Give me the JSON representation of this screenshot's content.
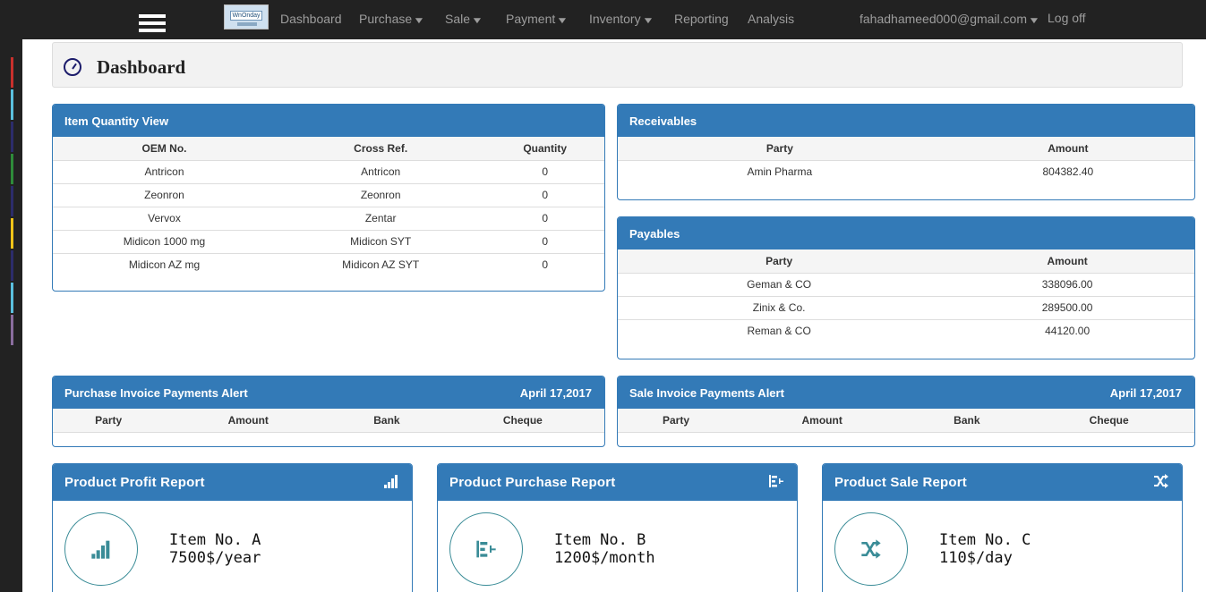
{
  "nav": {
    "logo_text": "WnOnday",
    "links": [
      {
        "label": "Dashboard",
        "dropdown": false
      },
      {
        "label": "Purchase",
        "dropdown": true
      },
      {
        "label": "Sale",
        "dropdown": true
      },
      {
        "label": "Payment",
        "dropdown": true
      },
      {
        "label": "Inventory",
        "dropdown": true
      },
      {
        "label": "Reporting",
        "dropdown": false
      },
      {
        "label": "Analysis",
        "dropdown": false
      }
    ],
    "user_email": "fahadhameed000@gmail.com",
    "logoff": "Log off"
  },
  "page": {
    "title": "Dashboard"
  },
  "item_quantity": {
    "title": "Item Quantity View",
    "headers": [
      "OEM No.",
      "Cross Ref.",
      "Quantity"
    ],
    "rows": [
      [
        "Antricon",
        "Antricon",
        "0"
      ],
      [
        "Zeonron",
        "Zeonron",
        "0"
      ],
      [
        "Vervox",
        "Zentar",
        "0"
      ],
      [
        "Midicon 1000 mg",
        "Midicon SYT",
        "0"
      ],
      [
        "Midicon AZ mg",
        "Midicon AZ SYT",
        "0"
      ]
    ]
  },
  "receivables": {
    "title": "Receivables",
    "headers": [
      "Party",
      "Amount"
    ],
    "rows": [
      [
        "Amin Pharma",
        "804382.40"
      ]
    ]
  },
  "payables": {
    "title": "Payables",
    "headers": [
      "Party",
      "Amount"
    ],
    "rows": [
      [
        "Geman & CO",
        "338096.00"
      ],
      [
        "Zinix & Co.",
        "289500.00"
      ],
      [
        "Reman & CO",
        "44120.00"
      ]
    ]
  },
  "purchase_alert": {
    "title": "Purchase Invoice Payments Alert",
    "date": "April 17,2017",
    "headers": [
      "Party",
      "Amount",
      "Bank",
      "Cheque"
    ]
  },
  "sale_alert": {
    "title": "Sale Invoice Payments Alert",
    "date": "April 17,2017",
    "headers": [
      "Party",
      "Amount",
      "Bank",
      "Cheque"
    ]
  },
  "reports": [
    {
      "title": "Product Profit Report",
      "icon": "signal-bars-icon",
      "item": "Item No. A",
      "value": "7500$/year"
    },
    {
      "title": "Product Purchase Report",
      "icon": "align-bars-icon",
      "item": "Item No. B",
      "value": "1200$/month"
    },
    {
      "title": "Product Sale Report",
      "icon": "shuffle-icon",
      "item": "Item No. C",
      "value": "110$/day"
    }
  ],
  "colors": {
    "navbar": "#222222",
    "panel_primary": "#337ab7",
    "icon_teal": "#3a8c97",
    "sidebar_strips": [
      "#c9302c",
      "#5bc0de",
      "#2c2c6b",
      "#2e8b3a",
      "#2c2c6b",
      "#f0c419",
      "#2c2c6b",
      "#5bc0de",
      "#8a6d9e"
    ]
  }
}
